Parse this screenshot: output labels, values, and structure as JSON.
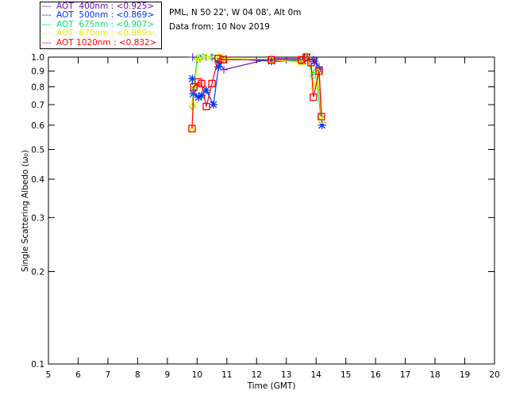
{
  "header": {
    "site": "PML, N 50 22', W 04 08', Alt 0m",
    "date": "Data from: 10 Nov 2019"
  },
  "legend": [
    {
      "text": "---  AOT  400nm : <0.925>",
      "color": "#6a0dad"
    },
    {
      "text": "---  AOT  500nm : <0.869>",
      "color": "#0033ff"
    },
    {
      "text": "---  AOT  675nm : <0.907>",
      "color": "#00e070"
    },
    {
      "text": "---  AOT  870nm : <0.889>",
      "color": "#ffff00"
    },
    {
      "text": "---  AOT 1020nm : <0.832>",
      "color": "#ff0000"
    }
  ],
  "chart_data": {
    "type": "line",
    "xlabel": "Time (GMT)",
    "ylabel": "Single Scattering Albedo (ω₀)",
    "xlim": [
      5,
      20
    ],
    "ylim": [
      0.1,
      1.0
    ],
    "yscale": "log",
    "xticks": [
      "5",
      "6",
      "7",
      "8",
      "9",
      "10",
      "11",
      "12",
      "13",
      "14",
      "15",
      "16",
      "17",
      "18",
      "19",
      "20"
    ],
    "yticks": [
      "0.1",
      "0.2",
      "0.3",
      "0.4",
      "0.5",
      "0.6",
      "0.7",
      "0.8",
      "0.9",
      "1.0"
    ],
    "series": [
      {
        "name": "AOT 400nm",
        "color": "#6a0dad",
        "marker": "plus",
        "points": [
          [
            9.85,
            1.0
          ],
          [
            10.1,
            0.99
          ],
          [
            10.3,
            1.0
          ],
          [
            10.5,
            1.0
          ],
          [
            10.72,
            0.96
          ],
          [
            10.9,
            0.91
          ],
          [
            12.5,
            0.99
          ],
          [
            13.6,
            0.99
          ],
          [
            13.9,
            0.98
          ],
          [
            14.1,
            0.93
          ]
        ]
      },
      {
        "name": "AOT 500nm",
        "color": "#0033ff",
        "marker": "asterisk",
        "points": [
          [
            9.84,
            0.85
          ],
          [
            9.87,
            0.76
          ],
          [
            10.05,
            0.74
          ],
          [
            10.15,
            0.75
          ],
          [
            10.3,
            0.78
          ],
          [
            10.55,
            0.7
          ],
          [
            10.72,
            0.93
          ],
          [
            10.88,
            0.99
          ],
          [
            12.5,
            0.97
          ],
          [
            13.55,
            0.97
          ],
          [
            13.7,
            1.0
          ],
          [
            13.95,
            0.97
          ],
          [
            14.1,
            0.91
          ],
          [
            14.2,
            0.6
          ]
        ]
      },
      {
        "name": "AOT 675nm",
        "color": "#00e070",
        "marker": "diamond",
        "points": [
          [
            9.84,
            0.69
          ],
          [
            9.88,
            0.79
          ],
          [
            10.0,
            0.99
          ],
          [
            10.2,
            1.0
          ],
          [
            10.5,
            1.0
          ],
          [
            10.72,
            0.99
          ],
          [
            10.88,
            0.99
          ],
          [
            12.5,
            0.98
          ],
          [
            13.5,
            0.97
          ],
          [
            13.7,
            1.0
          ],
          [
            13.9,
            0.87
          ],
          [
            14.0,
            0.9
          ],
          [
            14.15,
            0.64
          ]
        ]
      },
      {
        "name": "AOT 870nm",
        "color": "#ffff00",
        "marker": "triangle",
        "points": [
          [
            9.83,
            0.58
          ],
          [
            9.86,
            0.7
          ],
          [
            9.9,
            0.8
          ],
          [
            10.05,
            0.99
          ],
          [
            10.3,
            1.0
          ],
          [
            10.72,
            1.0
          ],
          [
            10.88,
            0.99
          ],
          [
            12.5,
            0.98
          ],
          [
            13.5,
            0.96
          ],
          [
            13.7,
            1.0
          ],
          [
            13.92,
            0.8
          ],
          [
            14.05,
            0.9
          ],
          [
            14.18,
            0.62
          ]
        ]
      },
      {
        "name": "AOT 1020nm",
        "color": "#ff0000",
        "marker": "square",
        "points": [
          [
            9.83,
            0.585
          ],
          [
            9.89,
            0.8
          ],
          [
            10.04,
            0.83
          ],
          [
            10.15,
            0.82
          ],
          [
            10.31,
            0.69
          ],
          [
            10.5,
            0.82
          ],
          [
            10.71,
            0.99
          ],
          [
            10.87,
            0.98
          ],
          [
            12.5,
            0.98
          ],
          [
            13.51,
            0.98
          ],
          [
            13.67,
            1.0
          ],
          [
            13.83,
            0.96
          ],
          [
            13.91,
            0.74
          ],
          [
            14.1,
            0.9
          ],
          [
            14.18,
            0.64
          ]
        ]
      }
    ]
  }
}
